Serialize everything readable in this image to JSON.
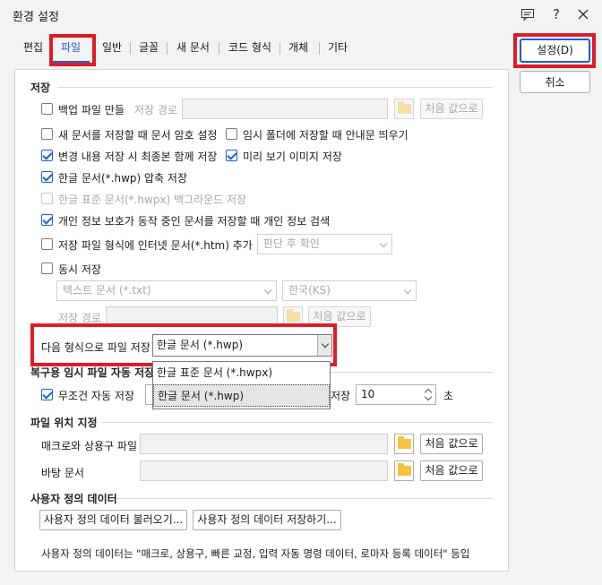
{
  "window": {
    "title": "환경 설정"
  },
  "titlebar_icons": [
    "comment-icon",
    "help-icon",
    "close-icon"
  ],
  "tabs": [
    {
      "label": "편집"
    },
    {
      "label": "파일"
    },
    {
      "label": "일반"
    },
    {
      "label": "글꼴"
    },
    {
      "label": "새 문서"
    },
    {
      "label": "코드 형식"
    },
    {
      "label": "개체"
    },
    {
      "label": "기타"
    }
  ],
  "active_tab": "파일",
  "buttons": {
    "ok": "설정(D)",
    "cancel": "취소"
  },
  "save": {
    "title": "저장",
    "backup": "백업 파일 만들",
    "save_path_label": "저장 경로",
    "default_button": "처음 값으로",
    "password_on_new": "새 문서를 저장할 때 문서 암호 설정",
    "temp_folder_notice": "임시 폴더에 저장할 때 안내문 띄우기",
    "save_with_final": "변경 내용 저장 시 최종본 함께 저장",
    "preview_image": "미리 보기 이미지 저장",
    "compress_hwp": "한글 문서(*.hwp) 압축 저장",
    "hwpx_background": "한글 표준 문서(*.hwpx) 백그라운드 저장",
    "privacy_check": "개인 정보 보호가 동작 중인 문서를 저장할 때 개인 정보 검색",
    "internet_format": "저장 파일 형식에 인터넷 문서(*.htm) 추가",
    "internet_select": "판단 후 확인",
    "simultaneous": "동시 저장",
    "text_format_select": "텍스트 문서 (*.txt)",
    "encoding_select": "한국(KS)",
    "save_path_label2": "저장 경로",
    "default_button2": "처음 값으로",
    "save_as_label": "다음 형식으로 파일 저장",
    "save_as_value": "한글 문서 (*.hwp)",
    "save_as_options": [
      "한글 표준 문서 (*.hwpx)",
      "한글 문서 (*.hwp)"
    ]
  },
  "recovery": {
    "title": "복구용 임시 파일 자동 저장",
    "always_auto": "무조건 자동 저장",
    "interval_label": "저장",
    "interval_value": "10",
    "interval_unit": "초"
  },
  "location": {
    "title": "파일 위치 지정",
    "macro_label": "매크로와 상용구 파일",
    "background_label": "바탕 문서",
    "default_button": "처음 값으로"
  },
  "user_data": {
    "title": "사용자 정의 데이터",
    "load_button": "사용자 정의 데이터 불러오기...",
    "save_button": "사용자 정의 데이터 저장하기...",
    "note": "사용자 정의 데이터는 \"매크로, 상용구, 빠른 교정, 입력 자동 명령 데이터, 로마자 등록 데이터\" 등입"
  },
  "states": {
    "backup": false,
    "password_on_new": false,
    "temp_folder_notice": false,
    "save_with_final": true,
    "preview_image": true,
    "compress_hwp": true,
    "hwpx_background": false,
    "privacy_check": true,
    "internet_format": false,
    "simultaneous": false,
    "always_auto": true
  },
  "colors": {
    "accent": "#1a5fd6",
    "highlight": "#e01b24"
  }
}
